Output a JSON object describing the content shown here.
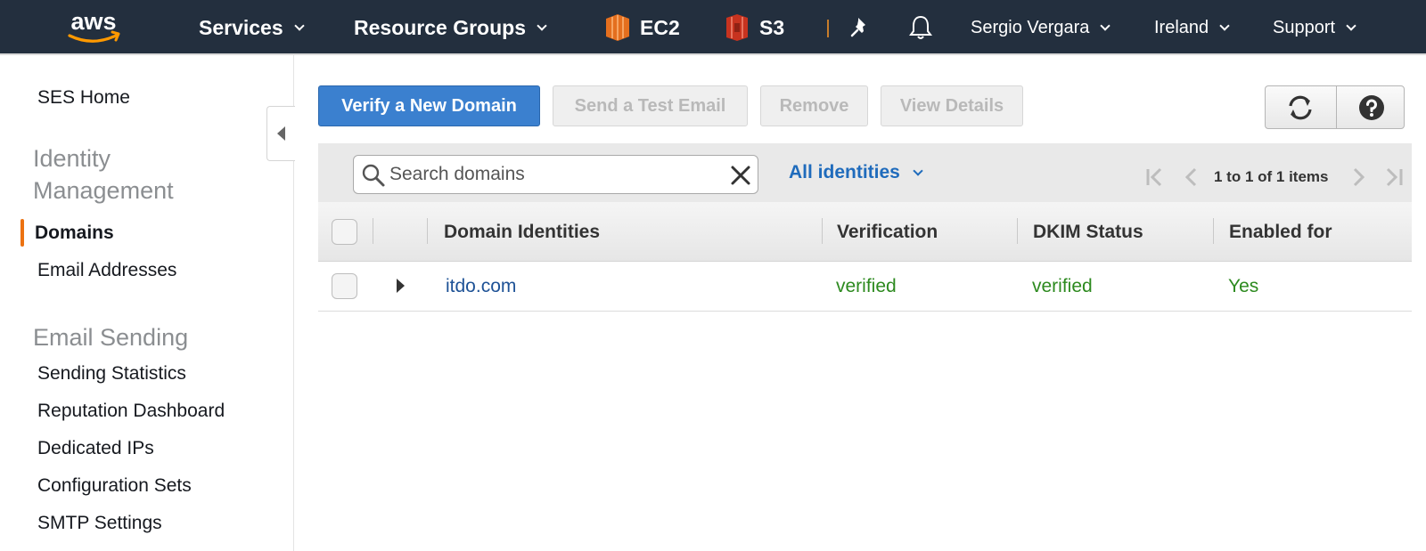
{
  "nav": {
    "services_label": "Services",
    "resource_groups_label": "Resource Groups",
    "ec2_label": "EC2",
    "s3_label": "S3",
    "user_label": "Sergio Vergara",
    "region_label": "Ireland",
    "support_label": "Support",
    "colors": {
      "background": "#232f3e",
      "logo_smile": "#ff9900",
      "ec2_icon": "#e46f1e",
      "s3_icon": "#c7331f"
    }
  },
  "sidebar": {
    "home_label": "SES Home",
    "identity_heading": "Identity Management",
    "identity_items": [
      {
        "label": "Domains",
        "active": true
      },
      {
        "label": "Email Addresses",
        "active": false
      }
    ],
    "sending_heading": "Email Sending",
    "sending_items": [
      {
        "label": "Sending Statistics"
      },
      {
        "label": "Reputation Dashboard"
      },
      {
        "label": "Dedicated IPs"
      },
      {
        "label": "Configuration Sets"
      },
      {
        "label": "SMTP Settings"
      }
    ],
    "active_color": "#ec7211"
  },
  "toolbar": {
    "verify_label": "Verify a New Domain",
    "send_test_label": "Send a Test Email",
    "remove_label": "Remove",
    "view_details_label": "View Details",
    "refresh_icon": "refresh-icon",
    "help_icon": "help-icon"
  },
  "filter": {
    "search_placeholder": "Search domains",
    "search_value": "",
    "identity_filter": "All identities",
    "pager_text": "1 to 1 of 1 items"
  },
  "table": {
    "columns": [
      "Domain Identities",
      "Verification",
      "DKIM Status",
      "Enabled for"
    ],
    "rows": [
      {
        "domain": "itdo.com",
        "verification": "verified",
        "dkim": "verified",
        "enabled": "Yes"
      }
    ],
    "colors": {
      "link": "#1e5296",
      "status_ok": "#2d8a1f"
    }
  }
}
